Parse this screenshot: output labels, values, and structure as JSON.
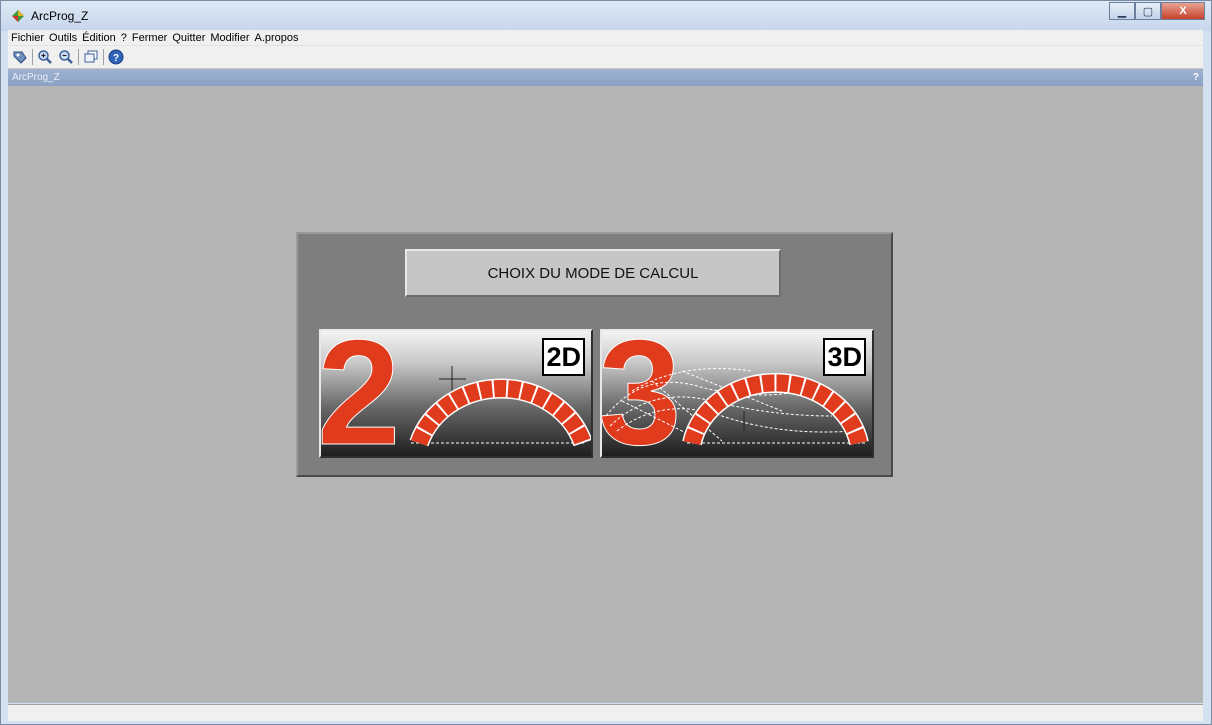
{
  "window": {
    "title": "ArcProg_Z"
  },
  "caption_buttons": {
    "minimize": "▁",
    "maximize": "▢",
    "close": "X"
  },
  "menu": [
    "Fichier",
    "Outils",
    "Édition",
    "?",
    "Fermer",
    "Quitter",
    "Modifier",
    "A.propos"
  ],
  "toolbar": {
    "icons": [
      "select-tool-icon",
      "zoom-in-icon",
      "zoom-out-icon",
      "window-icon",
      "help-icon"
    ]
  },
  "mdi": {
    "title": "ArcProg_Z",
    "help": "?"
  },
  "dialog": {
    "heading": "CHOIX DU MODE DE CALCUL",
    "modes": [
      {
        "digit": "2",
        "badge": "2D"
      },
      {
        "digit": "3",
        "badge": "3D"
      }
    ]
  },
  "colors": {
    "accent": "#e13b1e",
    "panel": "#7e7e7e",
    "client": "#b5b5b5"
  }
}
